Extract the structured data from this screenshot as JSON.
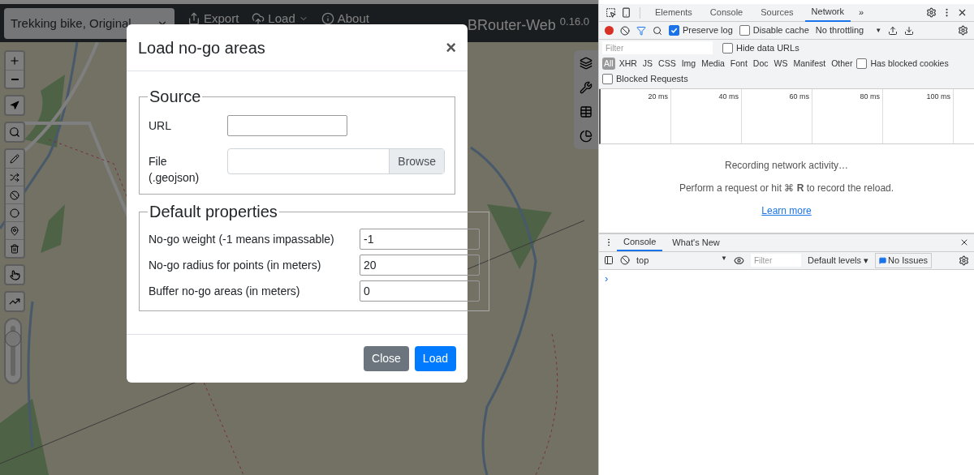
{
  "navbar": {
    "profile_select": "Trekking bike, Original",
    "items": [
      {
        "label": "Export",
        "kind": "export"
      },
      {
        "label": "Load",
        "kind": "load"
      },
      {
        "label": "About",
        "kind": "about"
      }
    ],
    "brand": "BRouter-Web",
    "version": "0.16.0"
  },
  "map": {
    "opacity_slider": {
      "level": 0.75
    }
  },
  "modal": {
    "title": "Load no-go areas",
    "close": "×",
    "source": {
      "legend": "Source",
      "url_label": "URL",
      "file_label": "File (.geojson)",
      "browse": "Browse"
    },
    "defaults": {
      "legend": "Default properties",
      "fields": [
        {
          "label": "No-go weight (-1 means impassable)",
          "value": "-1"
        },
        {
          "label": "No-go radius for points (in meters)",
          "value": "20"
        },
        {
          "label": "Buffer no-go areas (in meters)",
          "value": "0"
        }
      ]
    },
    "buttons": [
      {
        "label": "Close",
        "kind": "secondary"
      },
      {
        "label": "Load",
        "kind": "primary"
      }
    ]
  },
  "devtools": {
    "tabs": [
      {
        "label": "Elements",
        "selected": false
      },
      {
        "label": "Console",
        "selected": false
      },
      {
        "label": "Sources",
        "selected": false
      },
      {
        "label": "Network",
        "selected": true
      }
    ],
    "more": "»",
    "toolbar": {
      "preserve_log": {
        "label": "Preserve log",
        "checked": true
      },
      "disable_cache": {
        "label": "Disable cache",
        "checked": false
      },
      "throttling": "No throttling",
      "throttling_arrow": "▼"
    },
    "filter": {
      "placeholder": "Filter"
    },
    "hide_data_urls": {
      "label": "Hide data URLs",
      "checked": false
    },
    "types": [
      {
        "label": "All",
        "selected": true
      },
      {
        "label": "XHR",
        "selected": false
      },
      {
        "label": "JS",
        "selected": false
      },
      {
        "label": "CSS",
        "selected": false
      },
      {
        "label": "Img",
        "selected": false
      },
      {
        "label": "Media",
        "selected": false
      },
      {
        "label": "Font",
        "selected": false
      },
      {
        "label": "Doc",
        "selected": false
      },
      {
        "label": "WS",
        "selected": false
      },
      {
        "label": "Manifest",
        "selected": false
      },
      {
        "label": "Other",
        "selected": false
      }
    ],
    "has_blocked_cookies": {
      "label": "Has blocked cookies",
      "checked": false
    },
    "blocked_requests": {
      "label": "Blocked Requests",
      "checked": false
    },
    "timeline_ticks": [
      "20 ms",
      "40 ms",
      "60 ms",
      "80 ms",
      "100 ms"
    ],
    "empty": {
      "title": "Recording network activity…",
      "hint": "Perform a request or hit ⌘ **R** to record the reload.",
      "link": "Learn more"
    },
    "drawer": {
      "tabs": [
        {
          "label": "Console",
          "selected": true
        },
        {
          "label": "What's New",
          "selected": false
        }
      ],
      "context": "top",
      "context_arrow": "▼",
      "filter_placeholder": "Filter",
      "levels": "Default levels ▾",
      "issues": "No Issues",
      "prompt": "›"
    }
  }
}
